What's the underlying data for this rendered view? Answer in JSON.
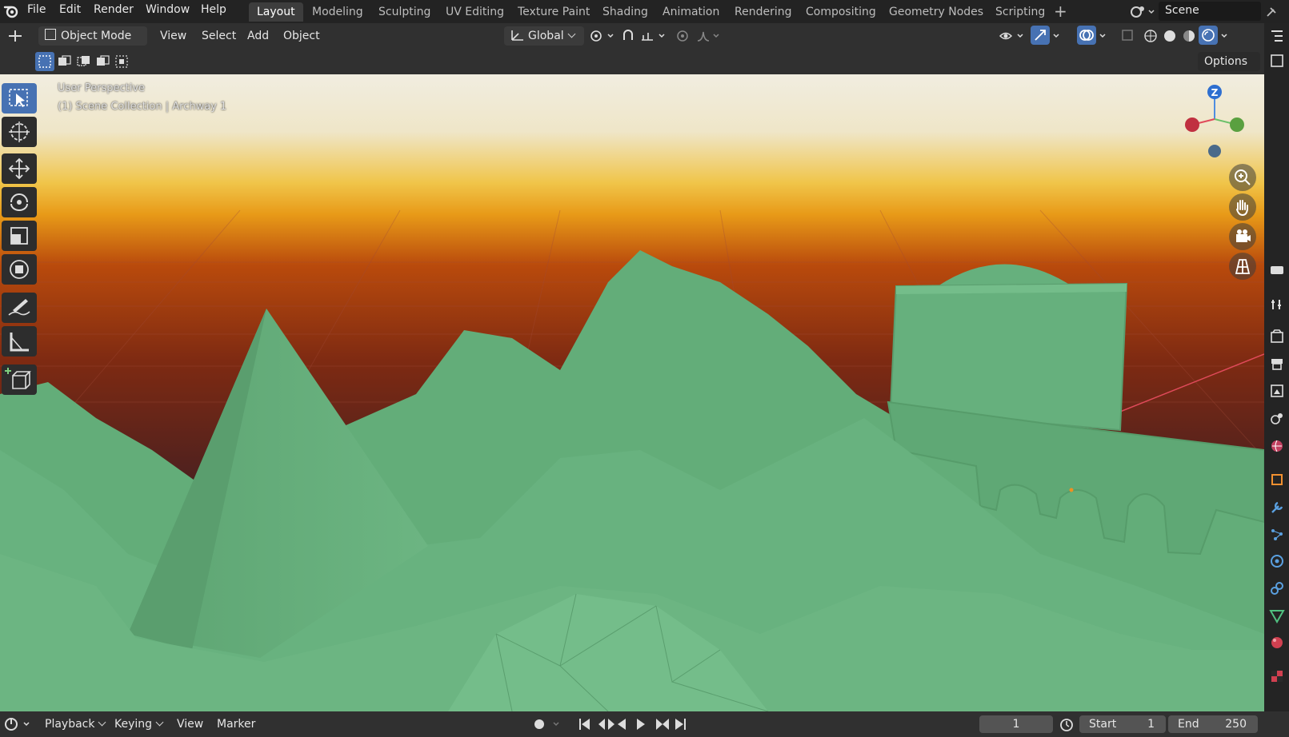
{
  "topbar": {
    "menus": [
      "File",
      "Edit",
      "Render",
      "Window",
      "Help"
    ],
    "workspaces": [
      "Layout",
      "Modeling",
      "Sculpting",
      "UV Editing",
      "Texture Paint",
      "Shading",
      "Animation",
      "Rendering",
      "Compositing",
      "Geometry Nodes",
      "Scripting"
    ],
    "active_workspace": "Layout",
    "scene_name": "Scene"
  },
  "header": {
    "mode": "Object Mode",
    "menus": [
      "View",
      "Select",
      "Add",
      "Object"
    ],
    "orientation": "Global",
    "options_label": "Options"
  },
  "viewport": {
    "perspective_label": "User Perspective",
    "collection_label": "(1) Scene Collection | Archway 1",
    "gizmo_axis": "Z"
  },
  "timeline": {
    "menus": [
      "Playback",
      "Keying",
      "View",
      "Marker"
    ],
    "current_frame": "1",
    "start_label": "Start",
    "start_value": "1",
    "end_label": "End",
    "end_value": "250"
  },
  "colors": {
    "terrain": "#66b07d",
    "accent": "#4772b3",
    "sky_top": "#f1ede0",
    "horizon": "#e89a18"
  }
}
